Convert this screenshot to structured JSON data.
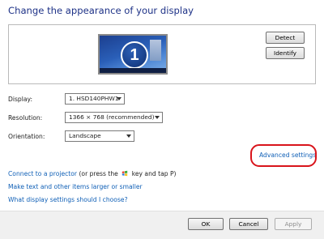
{
  "title": "Change the appearance of your display",
  "monitor": {
    "number": "1"
  },
  "buttons": {
    "detect": "Detect",
    "identify": "Identify"
  },
  "settings": {
    "display_label": "Display:",
    "display_value": "1. HSD140PHW1",
    "resolution_label": "Resolution:",
    "resolution_value": "1366 × 768 (recommended)",
    "orientation_label": "Orientation:",
    "orientation_value": "Landscape"
  },
  "advanced_link": "Advanced settings",
  "links": {
    "projector_link": "Connect to a projector",
    "projector_suffix_before": "(or press the",
    "projector_suffix_after": "key and tap P)",
    "text_size": "Make text and other items larger or smaller",
    "which_settings": "What display settings should I choose?"
  },
  "footer": {
    "ok": "OK",
    "cancel": "Cancel",
    "apply": "Apply"
  },
  "colors": {
    "title": "#1e3287",
    "link": "#0f5fb6",
    "highlight": "#d9141b"
  },
  "icons": [
    "windows-key-icon",
    "dropdown-arrow-icon"
  ]
}
